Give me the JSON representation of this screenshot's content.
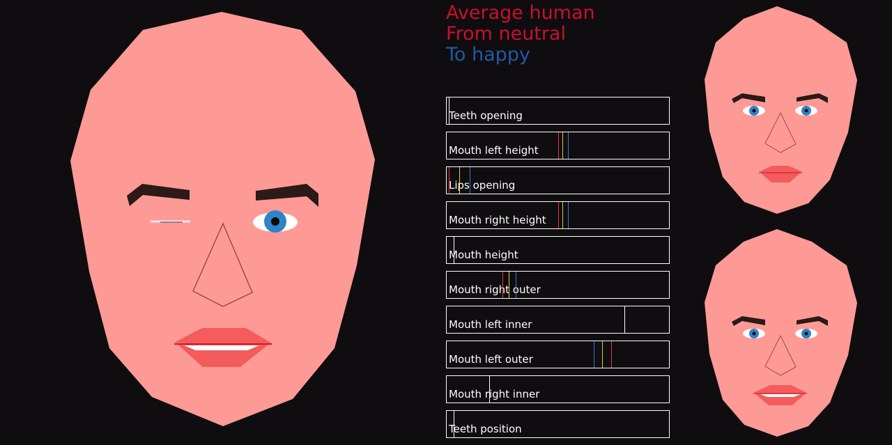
{
  "legend": {
    "subject": "Average human",
    "from": "From neutral",
    "to": "To happy",
    "colors": {
      "subject": "#c8102e",
      "from": "#c8102e",
      "to": "#1f5aa6"
    }
  },
  "sliders": [
    {
      "label": "Teeth opening",
      "markers": [
        {
          "value": 0.01,
          "color": "#ffffff"
        }
      ]
    },
    {
      "label": "Mouth left height",
      "markers": [
        {
          "value": 0.5,
          "color": "#e8334a"
        },
        {
          "value": 0.52,
          "color": "#e0d040"
        },
        {
          "value": 0.545,
          "color": "#3b78d6"
        }
      ]
    },
    {
      "label": "Lips opening",
      "markers": [
        {
          "value": 0.01,
          "color": "#e8334a"
        },
        {
          "value": 0.055,
          "color": "#e0d040"
        },
        {
          "value": 0.105,
          "color": "#3b78d6"
        }
      ]
    },
    {
      "label": "Mouth right height",
      "markers": [
        {
          "value": 0.5,
          "color": "#e8334a"
        },
        {
          "value": 0.52,
          "color": "#e0d040"
        },
        {
          "value": 0.545,
          "color": "#3b78d6"
        }
      ]
    },
    {
      "label": "Mouth height",
      "markers": [
        {
          "value": 0.03,
          "color": "#ffffff"
        }
      ]
    },
    {
      "label": "Mouth right outer",
      "markers": [
        {
          "value": 0.25,
          "color": "#e8334a"
        },
        {
          "value": 0.28,
          "color": "#e0d040"
        },
        {
          "value": 0.31,
          "color": "#3b78d6"
        }
      ]
    },
    {
      "label": "Mouth left inner",
      "markers": [
        {
          "value": 0.8,
          "color": "#ffffff"
        }
      ]
    },
    {
      "label": "Mouth left outer",
      "markers": [
        {
          "value": 0.66,
          "color": "#3b78d6"
        },
        {
          "value": 0.7,
          "color": "#e0d040"
        },
        {
          "value": 0.74,
          "color": "#e8334a"
        }
      ]
    },
    {
      "label": "Mouth right inner",
      "markers": [
        {
          "value": 0.19,
          "color": "#ffffff"
        }
      ]
    },
    {
      "label": "Teeth position",
      "markers": [
        {
          "value": 0.03,
          "color": "#ffffff"
        }
      ]
    }
  ],
  "colors": {
    "background": "#0f0d0f",
    "skin": "#fe9a96",
    "lips": "#f45b5b",
    "brow": "#2b1a17",
    "iris": "#2e83c9",
    "nose_line": "#9e4a4a"
  }
}
